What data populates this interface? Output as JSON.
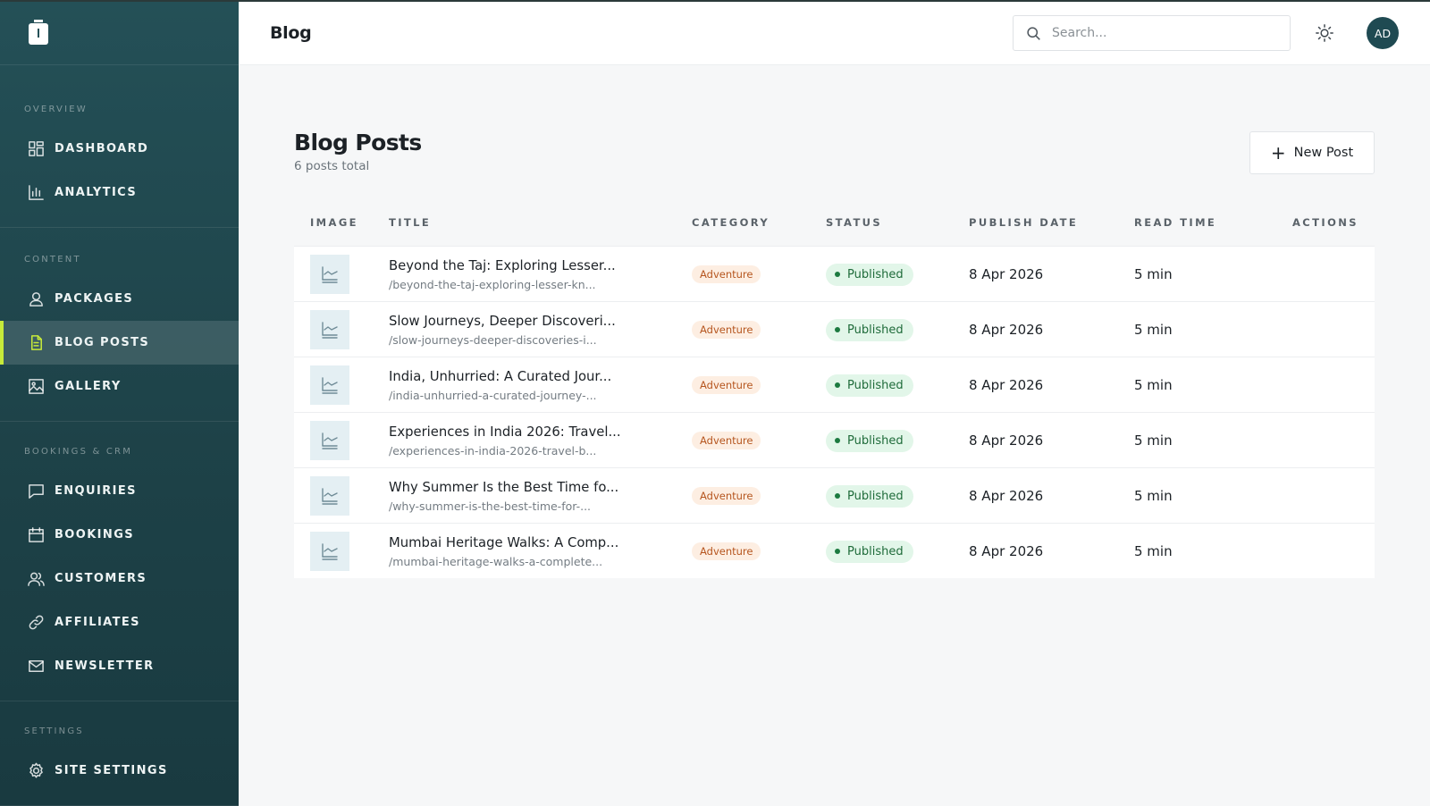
{
  "app": {
    "title": "Blog"
  },
  "search": {
    "placeholder": "Search..."
  },
  "user": {
    "initials": "AD"
  },
  "sidebar": {
    "sections": [
      {
        "label": "OVERVIEW",
        "items": [
          {
            "label": "DASHBOARD",
            "icon": "dashboard-icon"
          },
          {
            "label": "ANALYTICS",
            "icon": "bar-chart-icon"
          }
        ]
      },
      {
        "label": "CONTENT",
        "items": [
          {
            "label": "PACKAGES",
            "icon": "user-package-icon"
          },
          {
            "label": "BLOG POSTS",
            "icon": "document-icon",
            "active": true
          },
          {
            "label": "GALLERY",
            "icon": "image-icon"
          }
        ]
      },
      {
        "label": "BOOKINGS & CRM",
        "items": [
          {
            "label": "ENQUIRIES",
            "icon": "message-icon"
          },
          {
            "label": "BOOKINGS",
            "icon": "calendar-icon"
          },
          {
            "label": "CUSTOMERS",
            "icon": "users-icon"
          },
          {
            "label": "AFFILIATES",
            "icon": "link-icon"
          },
          {
            "label": "NEWSLETTER",
            "icon": "mail-icon"
          }
        ]
      },
      {
        "label": "SETTINGS",
        "items": [
          {
            "label": "SITE SETTINGS",
            "icon": "gear-icon"
          }
        ]
      }
    ]
  },
  "main": {
    "heading": "Blog Posts",
    "count_text": "6 posts total",
    "new_post_label": "New Post",
    "columns": [
      "IMAGE",
      "TITLE",
      "CATEGORY",
      "STATUS",
      "PUBLISH DATE",
      "READ TIME",
      "ACTIONS"
    ],
    "rows": [
      {
        "title": "Beyond the Taj: Exploring Lesser...",
        "slug": "/beyond-the-taj-exploring-lesser-kn...",
        "category": "Adventure",
        "status": "Published",
        "date": "8 Apr 2026",
        "read_time": "5 min"
      },
      {
        "title": "Slow Journeys, Deeper Discoveri...",
        "slug": "/slow-journeys-deeper-discoveries-i...",
        "category": "Adventure",
        "status": "Published",
        "date": "8 Apr 2026",
        "read_time": "5 min"
      },
      {
        "title": "India, Unhurried: A Curated Jour...",
        "slug": "/india-unhurried-a-curated-journey-...",
        "category": "Adventure",
        "status": "Published",
        "date": "8 Apr 2026",
        "read_time": "5 min"
      },
      {
        "title": "Experiences in India 2026: Travel...",
        "slug": "/experiences-in-india-2026-travel-b...",
        "category": "Adventure",
        "status": "Published",
        "date": "8 Apr 2026",
        "read_time": "5 min"
      },
      {
        "title": "Why Summer Is the Best Time fo...",
        "slug": "/why-summer-is-the-best-time-for-...",
        "category": "Adventure",
        "status": "Published",
        "date": "8 Apr 2026",
        "read_time": "5 min"
      },
      {
        "title": "Mumbai Heritage Walks: A Comp...",
        "slug": "/mumbai-heritage-walks-a-complete...",
        "category": "Adventure",
        "status": "Published",
        "date": "8 Apr 2026",
        "read_time": "5 min"
      }
    ]
  }
}
